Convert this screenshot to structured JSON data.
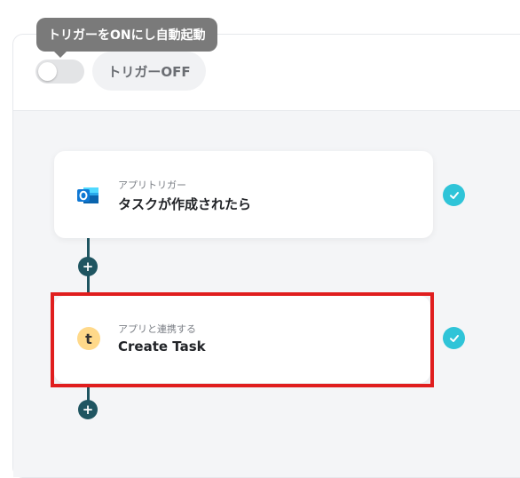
{
  "header": {
    "tooltip": "トリガーをONにし自動起動",
    "trigger_toggle_state": "off",
    "trigger_status_label": "トリガーOFF"
  },
  "flow": {
    "steps": [
      {
        "type_label": "アプリトリガー",
        "title": "タスクが作成されたら",
        "icon": "outlook-icon",
        "completed": true
      },
      {
        "type_label": "アプリと連携する",
        "title": "Create Task",
        "icon": "t-app-icon",
        "completed": true
      }
    ],
    "add_step_symbol": "+",
    "icon_letter": "t"
  },
  "colors": {
    "connector": "#1f5561",
    "check": "#2fc4d8",
    "highlight": "#e01e1e"
  }
}
